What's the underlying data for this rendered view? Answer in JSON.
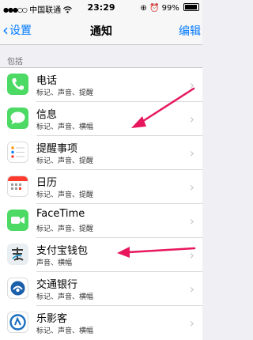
{
  "status_bar": {
    "carrier": "中国联通",
    "time": "23:29",
    "battery": "99%"
  },
  "nav": {
    "back_label": "设置",
    "title": "通知",
    "edit_label": "编辑"
  },
  "section_header": "包括",
  "apps": [
    {
      "name": "电话",
      "subtitle": "标记、声音、提醒"
    },
    {
      "name": "信息",
      "subtitle": "标记、声音、横幅"
    },
    {
      "name": "提醒事项",
      "subtitle": "标记、声音、提醒"
    },
    {
      "name": "日历",
      "subtitle": "标记、声音、提醒"
    },
    {
      "name": "FaceTime",
      "subtitle": "标记、声音、提醒"
    },
    {
      "name": "支付宝钱包",
      "subtitle": "声音、横幅"
    },
    {
      "name": "交通银行",
      "subtitle": "标记、声音、横幅"
    },
    {
      "name": "乐影客",
      "subtitle": "标记、声音、横幅"
    }
  ],
  "colors": {
    "accent": "#007aff",
    "arrow": "#e8175d"
  }
}
